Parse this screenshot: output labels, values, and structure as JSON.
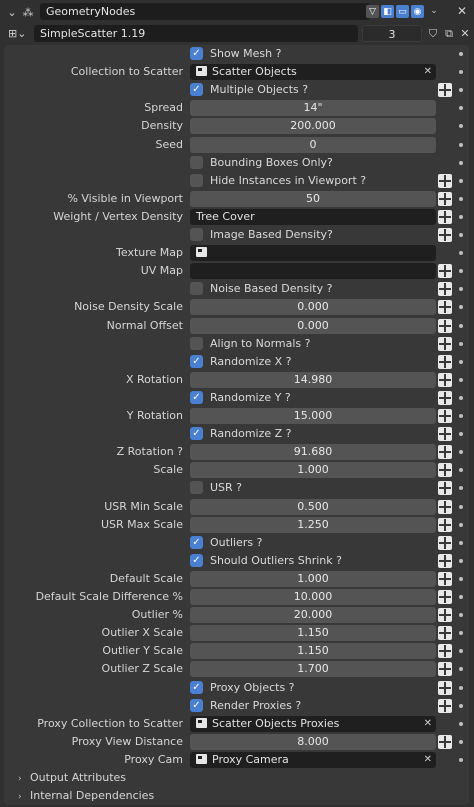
{
  "header": {
    "modifier_name": "GeometryNodes",
    "icons": [
      "wrench-icon",
      "node-dots-icon"
    ],
    "toggles": [
      "filter-icon",
      "editmode-icon",
      "viewport-icon",
      "render-icon"
    ],
    "close_glyph": "✕",
    "chevron": "⌄"
  },
  "node_group": {
    "name": "SimpleScatter 1.19",
    "users": "3",
    "icons": [
      "nodetree-icon",
      "shield-icon",
      "duplicate-icon",
      "close-icon"
    ]
  },
  "rows": [
    {
      "type": "checkbox",
      "label": "Show Mesh ?",
      "checked": true,
      "socket": false
    },
    {
      "type": "object",
      "label": "Collection to Scatter",
      "value": "Scatter Objects",
      "icon": "collection-icon",
      "close": true
    },
    {
      "type": "checkbox",
      "label": "Multiple Objects ?",
      "checked": true,
      "socket": true
    },
    {
      "type": "number",
      "label": "Spread",
      "value": "14\"",
      "socket": false
    },
    {
      "type": "number",
      "label": "Density",
      "value": "200.000",
      "socket": false
    },
    {
      "type": "number",
      "label": "Seed",
      "value": "0",
      "socket": false
    },
    {
      "type": "checkbox",
      "label": "Bounding Boxes Only?",
      "checked": false,
      "socket": false
    },
    {
      "type": "checkbox",
      "label": "Hide Instances in Viewport ?",
      "checked": false,
      "socket": true
    },
    {
      "type": "number",
      "label": "% Visible in Viewport",
      "value": "50",
      "socket": true
    },
    {
      "type": "text",
      "label": "Weight / Vertex Density",
      "value": "Tree Cover",
      "socket": true
    },
    {
      "type": "checkbox",
      "label": "Image Based Density?",
      "checked": false,
      "socket": true
    },
    {
      "type": "object",
      "label": "Texture Map",
      "value": "",
      "icon": "image-icon",
      "close": false
    },
    {
      "type": "text",
      "label": "UV Map",
      "value": "",
      "socket": true
    },
    {
      "type": "checkbox",
      "label": "Noise Based Density ?",
      "checked": false,
      "socket": true
    },
    {
      "type": "number",
      "label": "Noise Density Scale",
      "value": "0.000",
      "socket": true
    },
    {
      "type": "number",
      "label": "Normal Offset",
      "value": "0.000",
      "socket": true
    },
    {
      "type": "checkbox",
      "label": "Align to Normals ?",
      "checked": false,
      "socket": true
    },
    {
      "type": "checkbox",
      "label": "Randomize X ?",
      "checked": true,
      "socket": true
    },
    {
      "type": "number",
      "label": "X Rotation",
      "value": "14.980",
      "socket": true
    },
    {
      "type": "checkbox",
      "label": "Randomize Y ?",
      "checked": true,
      "socket": true
    },
    {
      "type": "number",
      "label": "Y Rotation",
      "value": "15.000",
      "socket": true
    },
    {
      "type": "checkbox",
      "label": "Randomize Z ?",
      "checked": true,
      "socket": true
    },
    {
      "type": "number",
      "label": "Z Rotation ?",
      "value": "91.680",
      "socket": true
    },
    {
      "type": "number",
      "label": "Scale",
      "value": "1.000",
      "socket": true
    },
    {
      "type": "checkbox",
      "label": " USR ?",
      "checked": false,
      "socket": true
    },
    {
      "type": "number",
      "label": "USR Min Scale",
      "value": "0.500",
      "socket": true
    },
    {
      "type": "number",
      "label": "USR Max Scale",
      "value": "1.250",
      "socket": true
    },
    {
      "type": "checkbox",
      "label": "Outliers ?",
      "checked": true,
      "socket": true
    },
    {
      "type": "checkbox",
      "label": "Should Outliers Shrink ?",
      "checked": true,
      "socket": true
    },
    {
      "type": "number",
      "label": "Default Scale",
      "value": "1.000",
      "socket": true
    },
    {
      "type": "number",
      "label": "Default Scale Difference %",
      "value": "10.000",
      "socket": true
    },
    {
      "type": "number",
      "label": "Outlier %",
      "value": "20.000",
      "socket": true
    },
    {
      "type": "number",
      "label": "Outlier X Scale",
      "value": "1.150",
      "socket": true
    },
    {
      "type": "number",
      "label": "Outlier Y Scale",
      "value": "1.150",
      "socket": true
    },
    {
      "type": "number",
      "label": "Outlier Z Scale",
      "value": "1.700",
      "socket": true
    },
    {
      "type": "checkbox",
      "label": "Proxy Objects ?",
      "checked": true,
      "socket": true
    },
    {
      "type": "checkbox",
      "label": "Render Proxies ?",
      "checked": true,
      "socket": true
    },
    {
      "type": "object",
      "label": "Proxy Collection to Scatter",
      "value": "Scatter Objects Proxies",
      "icon": "collection-icon",
      "close": true
    },
    {
      "type": "number",
      "label": "Proxy View Distance",
      "value": "8.000",
      "socket": true
    },
    {
      "type": "object",
      "label": "Proxy Cam",
      "value": "Proxy Camera",
      "icon": "camera-object-icon",
      "close": true
    }
  ],
  "collapsed_sections": [
    "Output Attributes",
    "Internal Dependencies"
  ],
  "colors": {
    "accent": "#4a7fd1",
    "panel": "#383838",
    "field": "#545454",
    "dark_field": "#1f1f1f"
  }
}
